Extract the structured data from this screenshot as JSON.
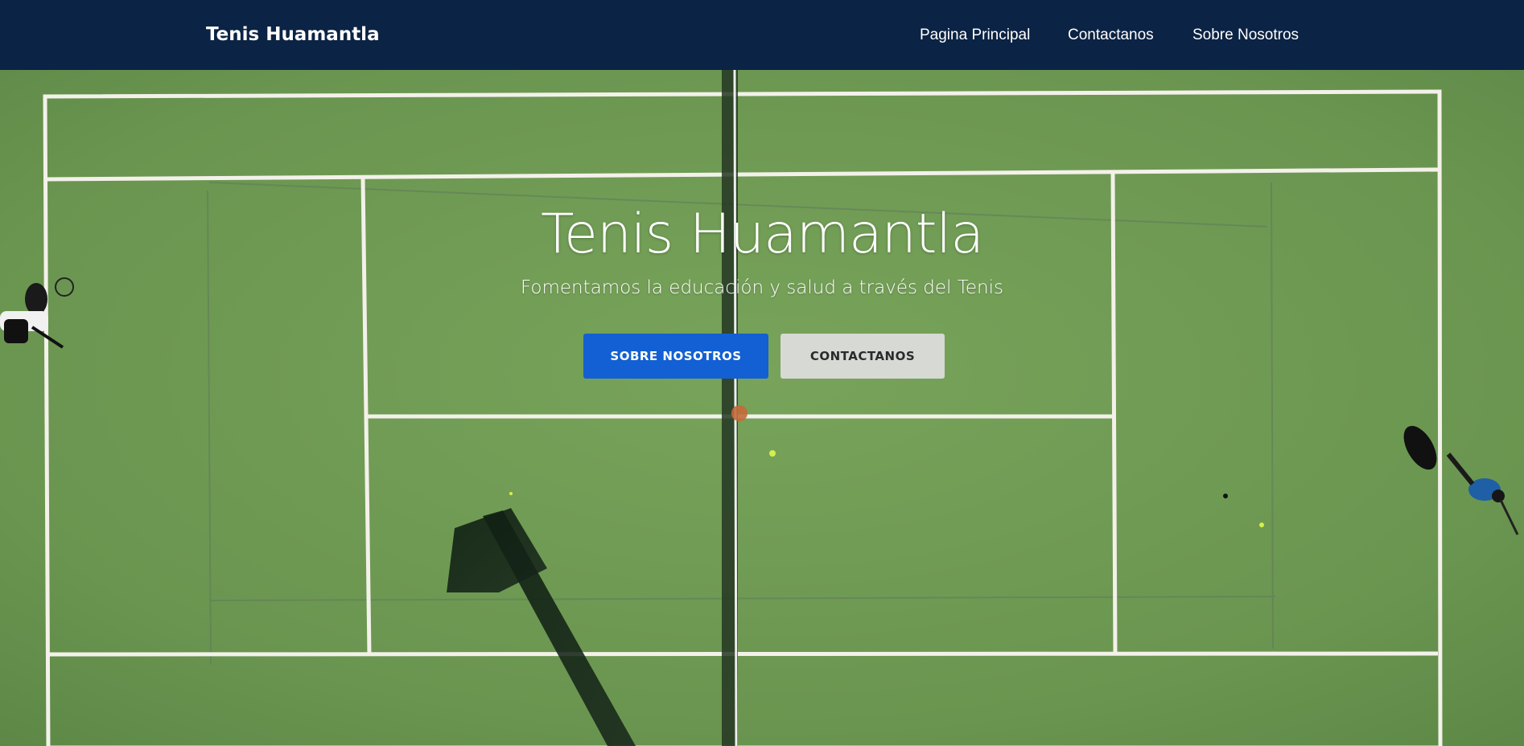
{
  "navbar": {
    "brand": "Tenis Huamantla",
    "links": [
      {
        "label": "Pagina Principal"
      },
      {
        "label": "Contactanos"
      },
      {
        "label": "Sobre Nosotros"
      }
    ],
    "background_color": "#0b2344"
  },
  "hero": {
    "title": "Tenis Huamantla",
    "subtitle": "Fomentamos la educación y salud a través del Tenis",
    "primary_button": "SOBRE NOSOTROS",
    "secondary_button": "CONTACTANOS",
    "primary_color": "#1260d3",
    "secondary_color": "#d6d9d4",
    "background_image": "aerial view of a green tennis court with white lines, players and a shadow"
  }
}
